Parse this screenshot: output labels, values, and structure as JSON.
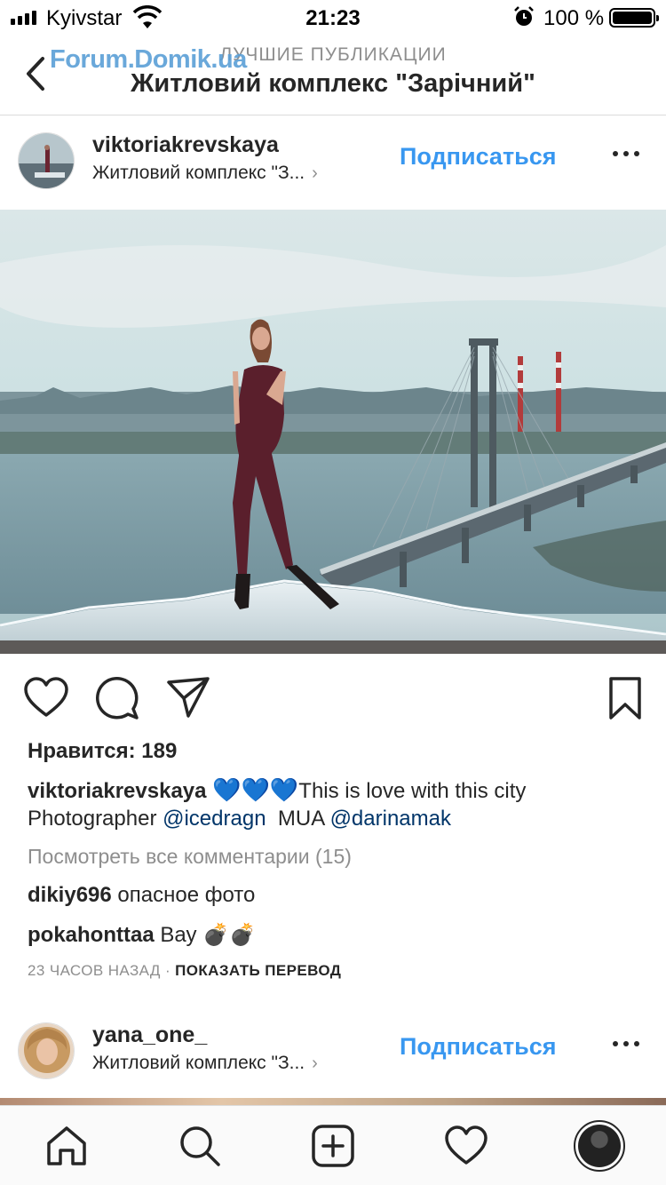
{
  "status_bar": {
    "carrier": "Kyivstar",
    "time": "21:23",
    "battery": "100 %",
    "icons": [
      "signal-icon",
      "wifi-icon",
      "alarm-icon",
      "battery-icon"
    ]
  },
  "nav": {
    "subtitle": "ЛУЧШИЕ ПУБЛИКАЦИИ",
    "title": "Житловий комплекс \"Зарічний\"",
    "watermark": "Forum.Domik.ua",
    "back_icon": "chevron-left-icon"
  },
  "posts": [
    {
      "username": "viktoriakrevskaya",
      "location": "Житловий комплекс \"З...",
      "follow_label": "Подписаться",
      "likes_label": "Нравится: 189",
      "caption": {
        "username": "viktoriakrevskaya",
        "hearts": "💙💙💙",
        "text": "This is love with this city",
        "line2_prefix": "Photographer ",
        "mention1": "@icedragn",
        "mid": "  MUA ",
        "mention2": "@darinamak"
      },
      "view_all_comments": "Посмотреть все комментарии (15)",
      "comments": [
        {
          "user": "dikiy696",
          "text": "опасное фото"
        },
        {
          "user": "pokahonttaa",
          "text": "Вау 💣💣"
        }
      ],
      "time_ago": "23 ЧАСОВ НАЗАД",
      "separator": " · ",
      "translate_label": "ПОКАЗАТЬ ПЕРЕВОД"
    },
    {
      "username": "yana_one_",
      "location": "Житловий комплекс \"З...",
      "follow_label": "Подписаться"
    }
  ],
  "action_icons": [
    "heart-icon",
    "comment-icon",
    "share-icon",
    "bookmark-icon"
  ],
  "tab_bar": [
    "home-icon",
    "search-icon",
    "add-icon",
    "activity-heart-icon",
    "profile-avatar"
  ],
  "colors": {
    "accent": "#3897f0",
    "text": "#262626",
    "muted": "#8e8e8e",
    "mention": "#003569",
    "divider": "#dbdbdb"
  }
}
